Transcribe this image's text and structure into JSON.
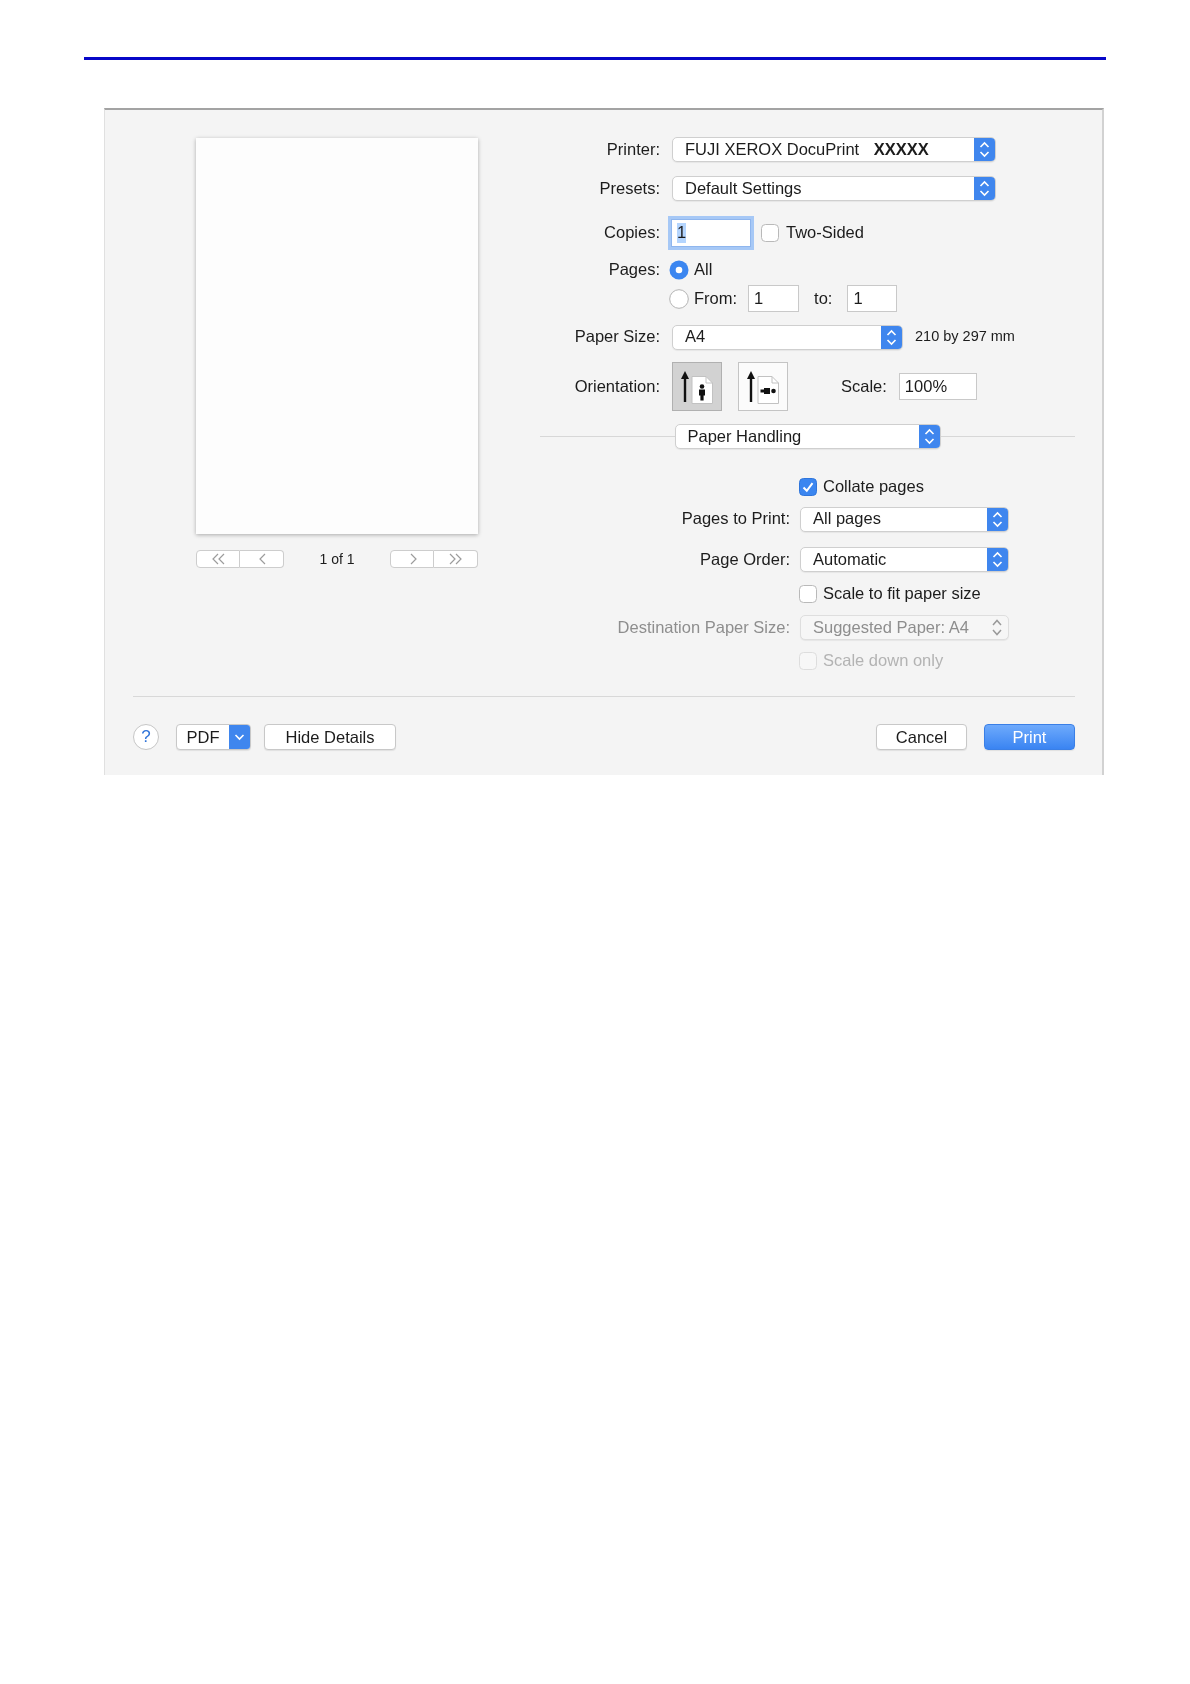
{
  "preview": {
    "page_indicator": "1 of 1"
  },
  "printer": {
    "label": "Printer:",
    "value": "FUJI XEROX DocuPrint **XXXXX**"
  },
  "presets": {
    "label": "Presets:",
    "value": "Default Settings"
  },
  "copies": {
    "label": "Copies:",
    "value": "1",
    "focused": true
  },
  "two_sided": {
    "label": "Two-Sided",
    "checked": false
  },
  "pages": {
    "label": "Pages:",
    "options": [
      {
        "kind": "all",
        "label": "All",
        "selected": true
      },
      {
        "kind": "range",
        "label": "From:",
        "selected": false,
        "from": "1",
        "to_label": "to:",
        "to": "1"
      }
    ]
  },
  "paper_size": {
    "label": "Paper Size:",
    "value": "A4",
    "dimensions": "210 by 297 mm"
  },
  "orientation": {
    "label": "Orientation:",
    "options": [
      {
        "kind": "portrait",
        "selected": true
      },
      {
        "kind": "landscape",
        "selected": false
      }
    ]
  },
  "scale": {
    "label": "Scale:",
    "value": "100%"
  },
  "section_menu": {
    "value": "Paper Handling"
  },
  "paper_handling": {
    "rows": [
      {
        "kind": "checkbox",
        "label": "Collate pages",
        "checked": true,
        "disabled": false
      },
      {
        "kind": "popup",
        "label": "Pages to Print:",
        "value": "All pages",
        "disabled": false
      },
      {
        "kind": "popup",
        "label": "Page Order:",
        "value": "Automatic",
        "disabled": false
      },
      {
        "kind": "checkbox",
        "label": "Scale to fit paper size",
        "checked": false,
        "disabled": false
      },
      {
        "kind": "popup",
        "label": "Destination Paper Size:",
        "value": "Suggested Paper: A4",
        "disabled": true
      },
      {
        "kind": "checkbox",
        "label": "Scale down only",
        "checked": false,
        "disabled": true
      }
    ]
  },
  "footer": {
    "help": "?",
    "pdf": "PDF",
    "details_button": "Hide Details",
    "buttons": [
      {
        "label": "Cancel",
        "primary": false
      },
      {
        "label": "Print",
        "primary": true
      }
    ]
  }
}
